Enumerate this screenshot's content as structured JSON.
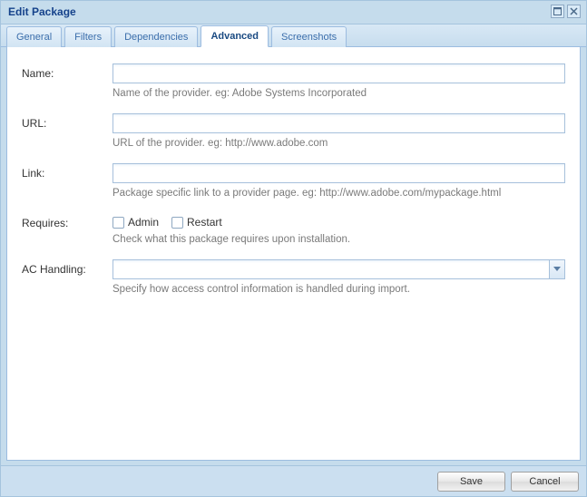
{
  "window": {
    "title": "Edit Package"
  },
  "tabs": [
    {
      "label": "General"
    },
    {
      "label": "Filters"
    },
    {
      "label": "Dependencies"
    },
    {
      "label": "Advanced"
    },
    {
      "label": "Screenshots"
    }
  ],
  "form": {
    "name": {
      "label": "Name:",
      "value": "",
      "hint": "Name of the provider. eg: Adobe Systems Incorporated"
    },
    "url": {
      "label": "URL:",
      "value": "",
      "hint": "URL of the provider. eg: http://www.adobe.com"
    },
    "link": {
      "label": "Link:",
      "value": "",
      "hint": "Package specific link to a provider page. eg: http://www.adobe.com/mypackage.html"
    },
    "requires": {
      "label": "Requires:",
      "admin_label": "Admin",
      "restart_label": "Restart",
      "hint": "Check what this package requires upon installation."
    },
    "ac_handling": {
      "label": "AC Handling:",
      "value": "",
      "hint": "Specify how access control information is handled during import."
    }
  },
  "buttons": {
    "save": "Save",
    "cancel": "Cancel"
  }
}
